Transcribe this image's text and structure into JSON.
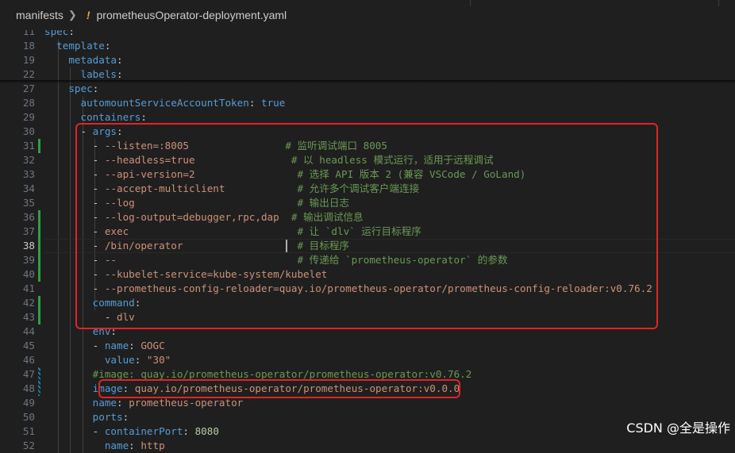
{
  "breadcrumb": {
    "folder": "manifests",
    "modified_marker": "!",
    "file": "prometheusOperator-deployment.yaml"
  },
  "lines": [
    {
      "n": "11",
      "t": [
        [
          "k",
          "spec"
        ],
        [
          "p",
          ":"
        ]
      ]
    },
    {
      "n": "18",
      "t": [
        [
          "p",
          "  "
        ],
        [
          "k",
          "template"
        ],
        [
          "p",
          ":"
        ]
      ]
    },
    {
      "n": "19",
      "t": [
        [
          "p",
          "    "
        ],
        [
          "k",
          "metadata"
        ],
        [
          "p",
          ":"
        ]
      ]
    },
    {
      "n": "22",
      "t": [
        [
          "p",
          "      "
        ],
        [
          "k",
          "labels"
        ],
        [
          "p",
          ":"
        ]
      ]
    },
    {
      "n": "27",
      "t": [
        [
          "p",
          "    "
        ],
        [
          "k",
          "spec"
        ],
        [
          "p",
          ":"
        ]
      ]
    },
    {
      "n": "28",
      "t": [
        [
          "p",
          "      "
        ],
        [
          "k",
          "automountServiceAccountToken"
        ],
        [
          "p",
          ": "
        ],
        [
          "b",
          "true"
        ]
      ]
    },
    {
      "n": "29",
      "t": [
        [
          "p",
          "      "
        ],
        [
          "k",
          "containers"
        ],
        [
          "p",
          ":"
        ]
      ]
    },
    {
      "n": "30",
      "t": [
        [
          "p",
          "      - "
        ],
        [
          "k",
          "args"
        ],
        [
          "p",
          ":"
        ]
      ]
    },
    {
      "n": "31",
      "t": [
        [
          "p",
          "        - "
        ],
        [
          "s",
          "--listen=:8005"
        ],
        [
          "p",
          "                "
        ],
        [
          "c",
          "# 监听调试端口 8005"
        ]
      ]
    },
    {
      "n": "32",
      "t": [
        [
          "p",
          "        - "
        ],
        [
          "s",
          "--headless=true"
        ],
        [
          "p",
          "                "
        ],
        [
          "c",
          "# 以 headless 模式运行，适用于远程调试"
        ]
      ]
    },
    {
      "n": "33",
      "t": [
        [
          "p",
          "        - "
        ],
        [
          "s",
          "--api-version=2"
        ],
        [
          "p",
          "                 "
        ],
        [
          "c",
          "# 选择 API 版本 2 (兼容 VSCode / GoLand)"
        ]
      ]
    },
    {
      "n": "34",
      "t": [
        [
          "p",
          "        - "
        ],
        [
          "s",
          "--accept-multiclient"
        ],
        [
          "p",
          "            "
        ],
        [
          "c",
          "# 允许多个调试客户端连接"
        ]
      ]
    },
    {
      "n": "35",
      "t": [
        [
          "p",
          "        - "
        ],
        [
          "s",
          "--log"
        ],
        [
          "p",
          "                           "
        ],
        [
          "c",
          "# 输出日志"
        ]
      ]
    },
    {
      "n": "36",
      "t": [
        [
          "p",
          "        - "
        ],
        [
          "s",
          "--log-output=debugger,rpc,dap"
        ],
        [
          "p",
          "  "
        ],
        [
          "c",
          "# 输出调试信息"
        ]
      ]
    },
    {
      "n": "37",
      "t": [
        [
          "p",
          "        - "
        ],
        [
          "s",
          "exec"
        ],
        [
          "p",
          "                            "
        ],
        [
          "c",
          "# 让 `dlv` 运行目标程序"
        ]
      ]
    },
    {
      "n": "38",
      "t": [
        [
          "p",
          "        - "
        ],
        [
          "s",
          "/bin/operator"
        ],
        [
          "p",
          "                   "
        ],
        [
          "c",
          "# 目标程序"
        ]
      ],
      "cur": true
    },
    {
      "n": "39",
      "t": [
        [
          "p",
          "        - "
        ],
        [
          "s",
          "--"
        ],
        [
          "p",
          "                              "
        ],
        [
          "c",
          "# 传递给 `prometheus-operator` 的参数"
        ]
      ]
    },
    {
      "n": "40",
      "t": [
        [
          "p",
          "        - "
        ],
        [
          "s",
          "--kubelet-service=kube-system/kubelet"
        ]
      ]
    },
    {
      "n": "41",
      "t": [
        [
          "p",
          "        - "
        ],
        [
          "s",
          "--prometheus-config-reloader=quay.io/prometheus-operator/prometheus-config-reloader:v0.76.2"
        ]
      ]
    },
    {
      "n": "42",
      "t": [
        [
          "p",
          "        "
        ],
        [
          "k",
          "command"
        ],
        [
          "p",
          ":"
        ]
      ]
    },
    {
      "n": "43",
      "t": [
        [
          "p",
          "          - "
        ],
        [
          "s",
          "dlv"
        ]
      ]
    },
    {
      "n": "44",
      "t": [
        [
          "p",
          "        "
        ],
        [
          "k",
          "env"
        ],
        [
          "p",
          ":"
        ]
      ]
    },
    {
      "n": "45",
      "t": [
        [
          "p",
          "        - "
        ],
        [
          "k",
          "name"
        ],
        [
          "p",
          ": "
        ],
        [
          "s",
          "GOGC"
        ]
      ]
    },
    {
      "n": "46",
      "t": [
        [
          "p",
          "          "
        ],
        [
          "k",
          "value"
        ],
        [
          "p",
          ": "
        ],
        [
          "s",
          "\"30\""
        ]
      ]
    },
    {
      "n": "47",
      "t": [
        [
          "p",
          "        "
        ],
        [
          "c",
          "#image: quay.io/prometheus-operator/prometheus-operator:v0.76.2"
        ]
      ]
    },
    {
      "n": "48",
      "t": [
        [
          "p",
          "        "
        ],
        [
          "k",
          "image"
        ],
        [
          "p",
          ": "
        ],
        [
          "s",
          "quay.io/prometheus-operator/prometheus-operator:v0.0.0"
        ]
      ]
    },
    {
      "n": "49",
      "t": [
        [
          "p",
          "        "
        ],
        [
          "k",
          "name"
        ],
        [
          "p",
          ": "
        ],
        [
          "s",
          "prometheus-operator"
        ]
      ]
    },
    {
      "n": "50",
      "t": [
        [
          "p",
          "        "
        ],
        [
          "k",
          "ports"
        ],
        [
          "p",
          ":"
        ]
      ]
    },
    {
      "n": "51",
      "t": [
        [
          "p",
          "        - "
        ],
        [
          "k",
          "containerPort"
        ],
        [
          "p",
          ": "
        ],
        [
          "n",
          "8080"
        ]
      ]
    },
    {
      "n": "52",
      "t": [
        [
          "p",
          "          "
        ],
        [
          "k",
          "name"
        ],
        [
          "p",
          ": "
        ],
        [
          "s",
          "http"
        ]
      ]
    }
  ],
  "watermark": "CSDN @全是操作",
  "colors": {
    "key": "#569cd6",
    "string": "#ce9178",
    "comment": "#6a9955",
    "number": "#b5cea8",
    "highlight_box": "#e02424",
    "modified_gutter": "#2ea043"
  }
}
